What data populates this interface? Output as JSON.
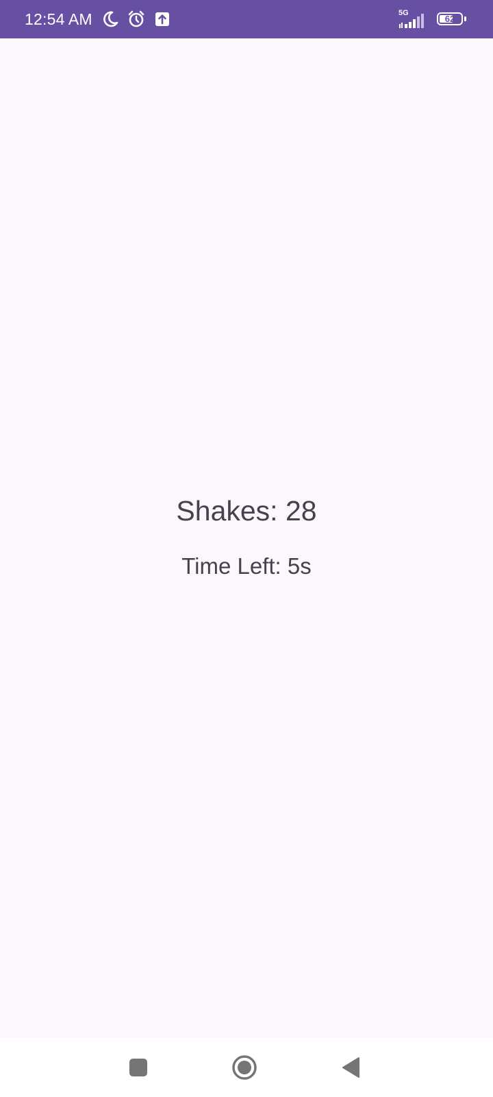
{
  "status_bar": {
    "time": "12:54 AM",
    "icons": [
      "moon-icon",
      "alarm-icon",
      "upload-icon"
    ],
    "network": "5G",
    "battery_level": "62",
    "battery_fraction": 0.62,
    "color": "#6750a4"
  },
  "main": {
    "shakes_text": "Shakes: 28",
    "time_left_text": "Time Left: 5s"
  },
  "nav_bar": {
    "buttons": [
      "recents-icon",
      "home-icon",
      "back-icon"
    ]
  }
}
